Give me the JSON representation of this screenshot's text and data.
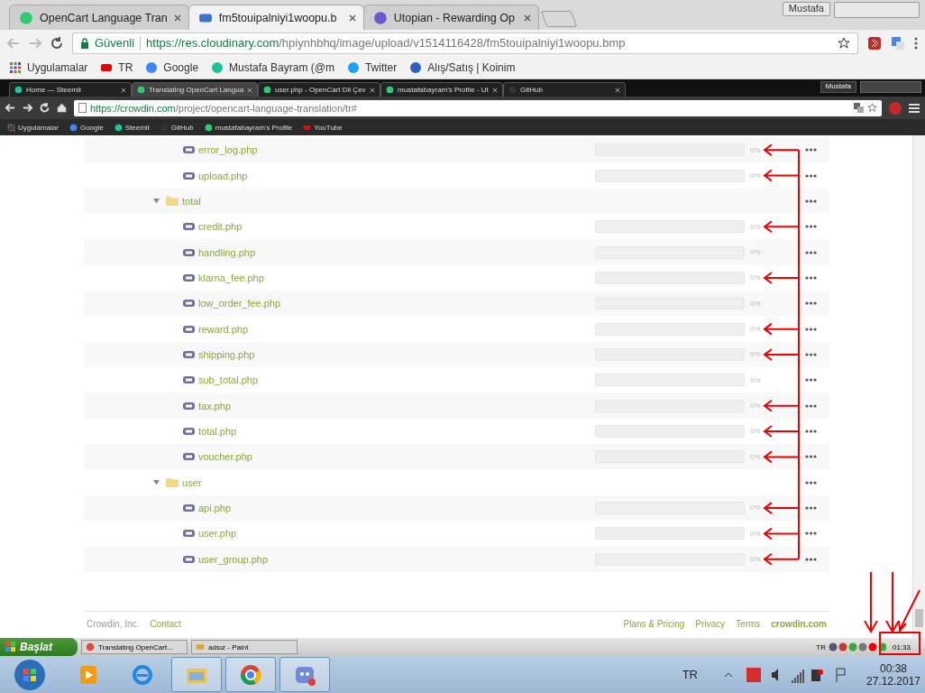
{
  "outer_browser": {
    "tabs": [
      {
        "title": "OpenCart Language Tran",
        "selected": false
      },
      {
        "title": "fm5touipalniyi1woopu.b",
        "selected": true
      },
      {
        "title": "Utopian - Rewarding Op",
        "selected": false
      }
    ],
    "profile": "Mustafa",
    "address": {
      "secure_label": "Güvenli",
      "host": "https://res.cloudinary.com",
      "path": "/hpiynhbhq/image/upload/v1514116428/fm5touipalniyi1woopu.bmp"
    },
    "bookmarks": [
      "Uygulamalar",
      "TR",
      "Google",
      "Mustafa Bayram (@m",
      "Twitter",
      "Alış/Satış | Koinim"
    ]
  },
  "inner_browser": {
    "tabs": [
      {
        "title": "Home — Steemit",
        "selected": false
      },
      {
        "title": "Translating OpenCart Langua",
        "selected": true
      },
      {
        "title": "user.php - OpenCart Dil Çev",
        "selected": false
      },
      {
        "title": "mustafabayram's Profile - Ut",
        "selected": false
      },
      {
        "title": "GitHub",
        "selected": false
      }
    ],
    "profile": "Mustafa",
    "address": {
      "host": "https://crowdin.com",
      "path": "/project/opencart-language-translation/tr#"
    },
    "bookmarks": [
      "Uygulamalar",
      "Google",
      "Steemit",
      "GitHub",
      "mustafabayram's Profile",
      "YouTube"
    ]
  },
  "tree": [
    {
      "kind": "partial_folder",
      "children": [
        {
          "kind": "file",
          "name": "error_log.php",
          "progress": "0%",
          "level": 0,
          "marked": true
        },
        {
          "kind": "file",
          "name": "upload.php",
          "progress": "0%",
          "level": 0,
          "marked": true
        }
      ]
    },
    {
      "kind": "folder",
      "name": "total",
      "expanded": true,
      "children": [
        {
          "kind": "file",
          "name": "credit.php",
          "progress": "0%",
          "level": 0,
          "marked": true
        },
        {
          "kind": "file",
          "name": "handling.php",
          "progress": "0%",
          "level": 0,
          "marked": false
        },
        {
          "kind": "file",
          "name": "klarna_fee.php",
          "progress": "0%",
          "level": 0,
          "marked": true
        },
        {
          "kind": "file",
          "name": "low_order_fee.php",
          "progress": "0%",
          "level": 0,
          "marked": false
        },
        {
          "kind": "file",
          "name": "reward.php",
          "progress": "0%",
          "level": 0,
          "marked": true
        },
        {
          "kind": "file",
          "name": "shipping.php",
          "progress": "0%",
          "level": 0,
          "marked": true
        },
        {
          "kind": "file",
          "name": "sub_total.php",
          "progress": "0%",
          "level": 0,
          "marked": false
        },
        {
          "kind": "file",
          "name": "tax.php",
          "progress": "0%",
          "level": 0,
          "marked": true
        },
        {
          "kind": "file",
          "name": "total.php",
          "progress": "0%",
          "level": 0,
          "marked": true
        },
        {
          "kind": "file",
          "name": "voucher.php",
          "progress": "0%",
          "level": 0,
          "marked": true
        }
      ]
    },
    {
      "kind": "folder",
      "name": "user",
      "expanded": true,
      "children": [
        {
          "kind": "file",
          "name": "api.php",
          "progress": "0%",
          "level": 0,
          "marked": true
        },
        {
          "kind": "file",
          "name": "user.php",
          "progress": "0%",
          "level": 0,
          "marked": true
        },
        {
          "kind": "file",
          "name": "user_group.php",
          "progress": "0%",
          "level": 0,
          "marked": true
        }
      ]
    }
  ],
  "footer": {
    "company": "Crowdin, Inc.",
    "left_links": [
      "Contact"
    ],
    "right_links": [
      "Plans & Pricing",
      "Privacy",
      "Terms"
    ],
    "brand": "crowdin.com"
  },
  "inner_taskbar": {
    "start": "Başlat",
    "tasks": [
      "Translating OpenCart...",
      "adsız - Paint"
    ],
    "language": "TR",
    "clock": "01:33",
    "clock_highlighted": true
  },
  "taskbar": {
    "apps": [
      {
        "selected": false
      },
      {
        "selected": false
      },
      {
        "selected": true
      },
      {
        "selected": true
      },
      {
        "selected": true
      }
    ],
    "language": "TR",
    "time": "00:38",
    "date": "27.12.2017"
  }
}
